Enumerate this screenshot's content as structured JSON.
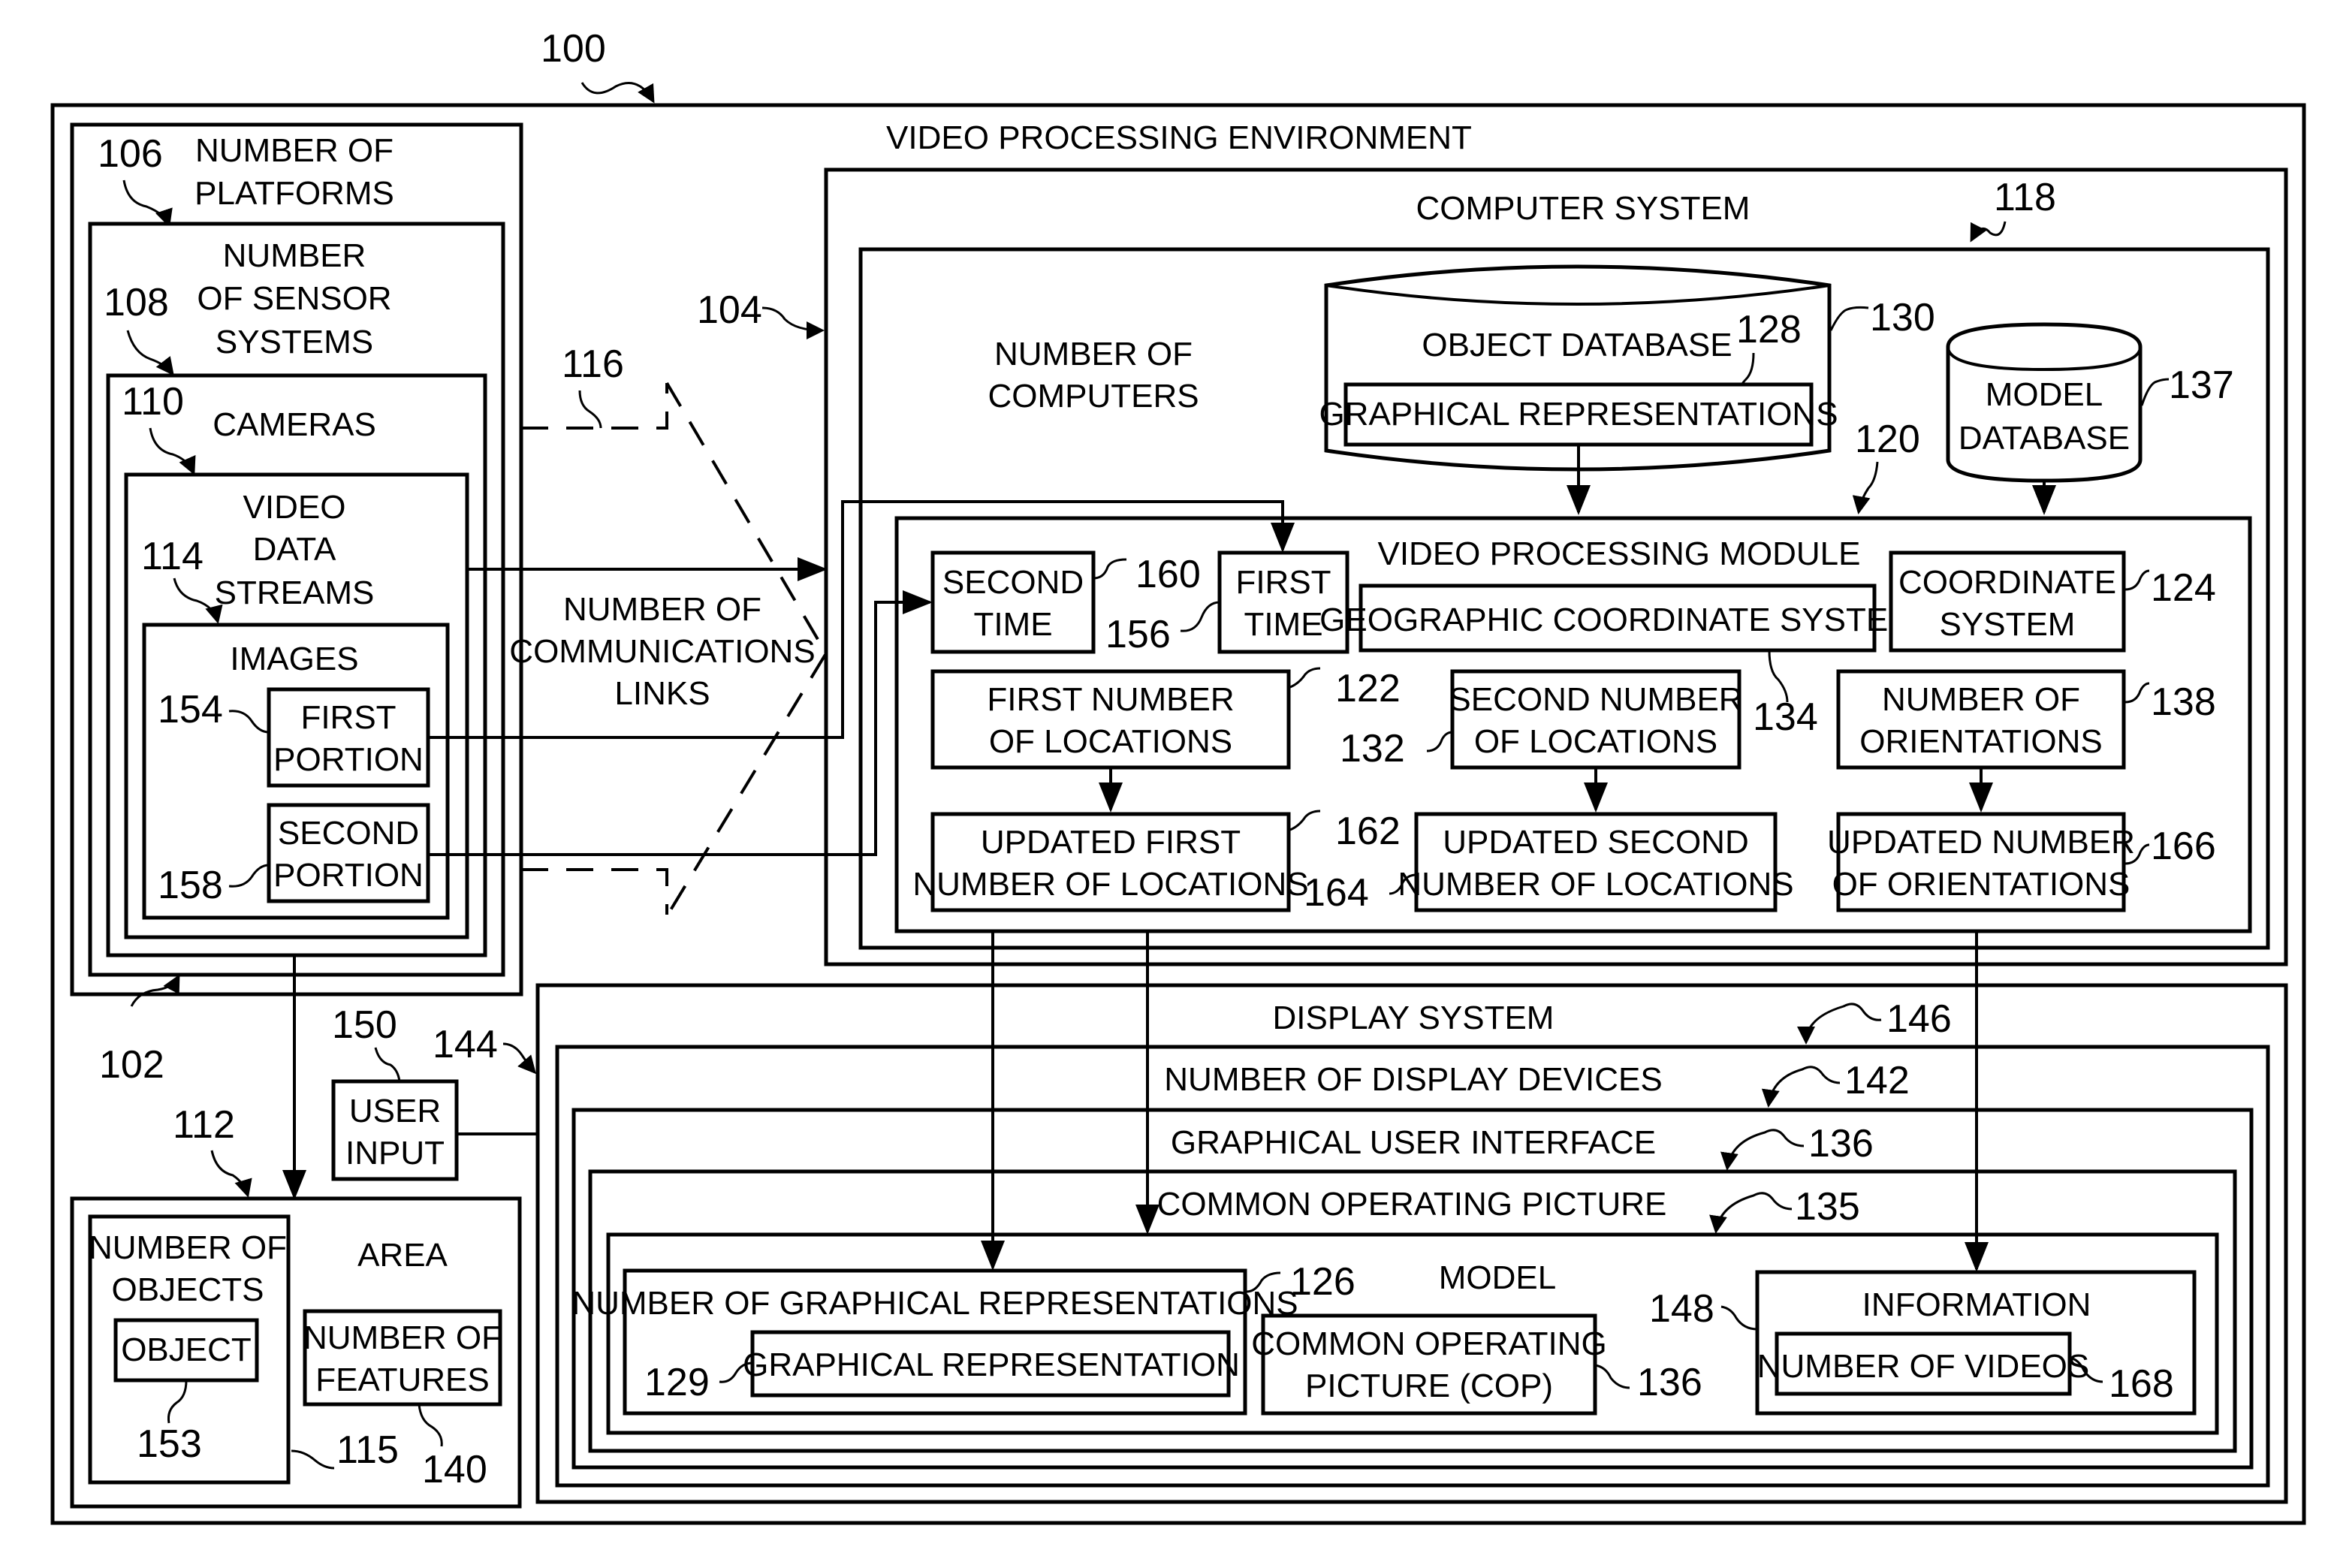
{
  "figure": {
    "ref": "100",
    "title": "VIDEO PROCESSING ENVIRONMENT"
  },
  "platforms": {
    "ref": "106",
    "label1": "NUMBER OF",
    "label2": "PLATFORMS",
    "group_ref": "102"
  },
  "sensor_systems": {
    "ref": "108",
    "label1": "NUMBER",
    "label2": "OF SENSOR",
    "label3": "SYSTEMS"
  },
  "cameras": {
    "ref": "110",
    "label": "CAMERAS"
  },
  "video_streams": {
    "ref": "114",
    "label1": "VIDEO",
    "label2": "DATA",
    "label3": "STREAMS"
  },
  "images": {
    "label": "IMAGES"
  },
  "first_portion": {
    "ref": "154",
    "label1": "FIRST",
    "label2": "PORTION"
  },
  "second_portion": {
    "ref": "158",
    "label1": "SECOND",
    "label2": "PORTION"
  },
  "comm_links": {
    "ref": "116",
    "label1": "NUMBER OF",
    "label2": "COMMUNICATIONS",
    "label3": "LINKS"
  },
  "computer_system": {
    "ref": "104",
    "label": "COMPUTER SYSTEM",
    "inner_ref": "118"
  },
  "computers": {
    "label1": "NUMBER OF",
    "label2": "COMPUTERS"
  },
  "object_db": {
    "ref": "130",
    "label": "OBJECT DATABASE",
    "sub_ref": "128",
    "sub_label": "GRAPHICAL REPRESENTATIONS"
  },
  "model_db": {
    "ref": "137",
    "label1": "MODEL",
    "label2": "DATABASE"
  },
  "vpm": {
    "ref": "120",
    "label": "VIDEO PROCESSING MODULE"
  },
  "second_time": {
    "ref": "160",
    "label1": "SECOND",
    "label2": "TIME"
  },
  "first_time": {
    "ref": "156",
    "label1": "FIRST",
    "label2": "TIME"
  },
  "geo_coord": {
    "ref": "134",
    "label": "GEOGRAPHIC COORDINATE SYSTEM"
  },
  "coord_system": {
    "ref": "124",
    "label1": "COORDINATE",
    "label2": "SYSTEM"
  },
  "first_locations": {
    "ref": "122",
    "label1": "FIRST NUMBER",
    "label2": "OF LOCATIONS"
  },
  "second_locations": {
    "ref": "132",
    "label1": "SECOND NUMBER",
    "label2": "OF LOCATIONS"
  },
  "orientations": {
    "ref": "138",
    "label1": "NUMBER OF",
    "label2": "ORIENTATIONS"
  },
  "upd_first": {
    "ref": "162",
    "label1": "UPDATED FIRST",
    "label2": "NUMBER OF LOCATIONS"
  },
  "upd_second": {
    "ref": "164",
    "label1": "UPDATED SECOND",
    "label2": "NUMBER OF LOCATIONS"
  },
  "upd_orient": {
    "ref": "166",
    "label1": "UPDATED NUMBER",
    "label2": "OF ORIENTATIONS"
  },
  "user_input": {
    "ref": "150",
    "label1": "USER",
    "label2": "INPUT"
  },
  "display_system": {
    "ref": "144",
    "label": "DISPLAY SYSTEM",
    "inner_ref": "146"
  },
  "display_devices": {
    "label": "NUMBER OF DISPLAY DEVICES",
    "inner_ref": "142"
  },
  "gui": {
    "label": "GRAPHICAL USER INTERFACE",
    "inner_ref": "136"
  },
  "cop": {
    "label": "COMMON OPERATING PICTURE",
    "inner_ref": "135"
  },
  "model": {
    "label": "MODEL"
  },
  "graph_reps": {
    "ref": "126",
    "label": "NUMBER OF GRAPHICAL REPRESENTATIONS"
  },
  "graph_rep": {
    "ref": "129",
    "label": "GRAPHICAL REPRESENTATION"
  },
  "cop_box": {
    "ref": "136",
    "label1": "COMMON OPERATING",
    "label2": "PICTURE (COP)"
  },
  "information": {
    "ref": "148",
    "label": "INFORMATION"
  },
  "videos": {
    "ref": "168",
    "label": "NUMBER OF VIDEOS"
  },
  "area": {
    "ref": "112",
    "label": "AREA"
  },
  "objects": {
    "ref": "115",
    "label1": "NUMBER OF",
    "label2": "OBJECTS"
  },
  "object": {
    "ref": "153",
    "label": "OBJECT"
  },
  "features": {
    "ref": "140",
    "label1": "NUMBER OF",
    "label2": "FEATURES"
  }
}
